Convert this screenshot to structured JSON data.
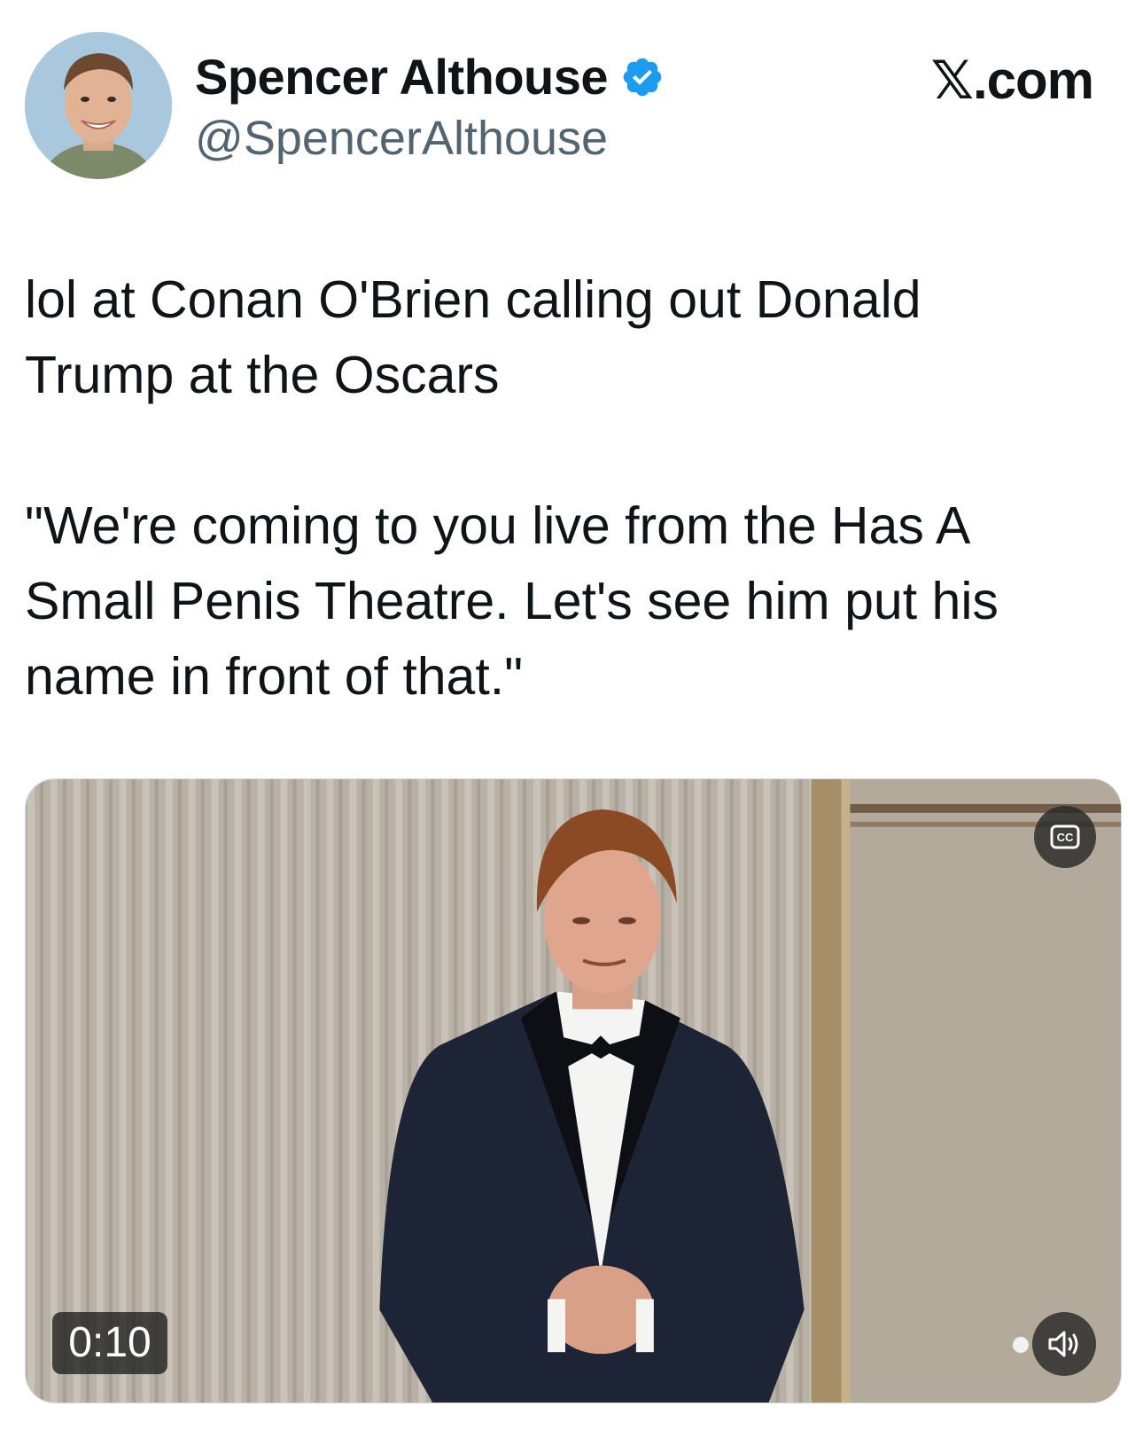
{
  "author": {
    "display_name": "Spencer Althouse",
    "handle": "@SpencerAlthouse",
    "verified": true,
    "verified_color": "#1d9bf0"
  },
  "brand": {
    "label": "𝕏.com"
  },
  "tweet": {
    "text": "lol at Conan O'Brien calling out Donald\nTrump at the Oscars\n\n\"We're coming to you live from the Has A\nSmall Penis Theatre. Let's see him put his\nname in front of that.\""
  },
  "media": {
    "duration": "0:10",
    "captions_icon": "cc-icon",
    "volume_icon": "speaker-icon"
  }
}
